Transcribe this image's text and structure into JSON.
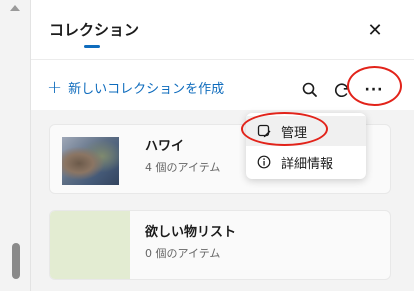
{
  "panel": {
    "title": "コレクション",
    "close_label": "✕"
  },
  "toolbar": {
    "new_collection_label": "新しいコレクションを作成",
    "more_label": "···"
  },
  "collections": [
    {
      "name": "ハワイ",
      "count_label": "4 個のアイテム"
    },
    {
      "name": "欲しい物リスト",
      "count_label": "0 個のアイテム"
    }
  ],
  "menu": {
    "items": [
      {
        "label": "管理",
        "icon": "manage-icon"
      },
      {
        "label": "詳細情報",
        "icon": "info-icon"
      }
    ]
  },
  "colors": {
    "accent": "#0f6cbd",
    "annotation": "#e2231a"
  }
}
